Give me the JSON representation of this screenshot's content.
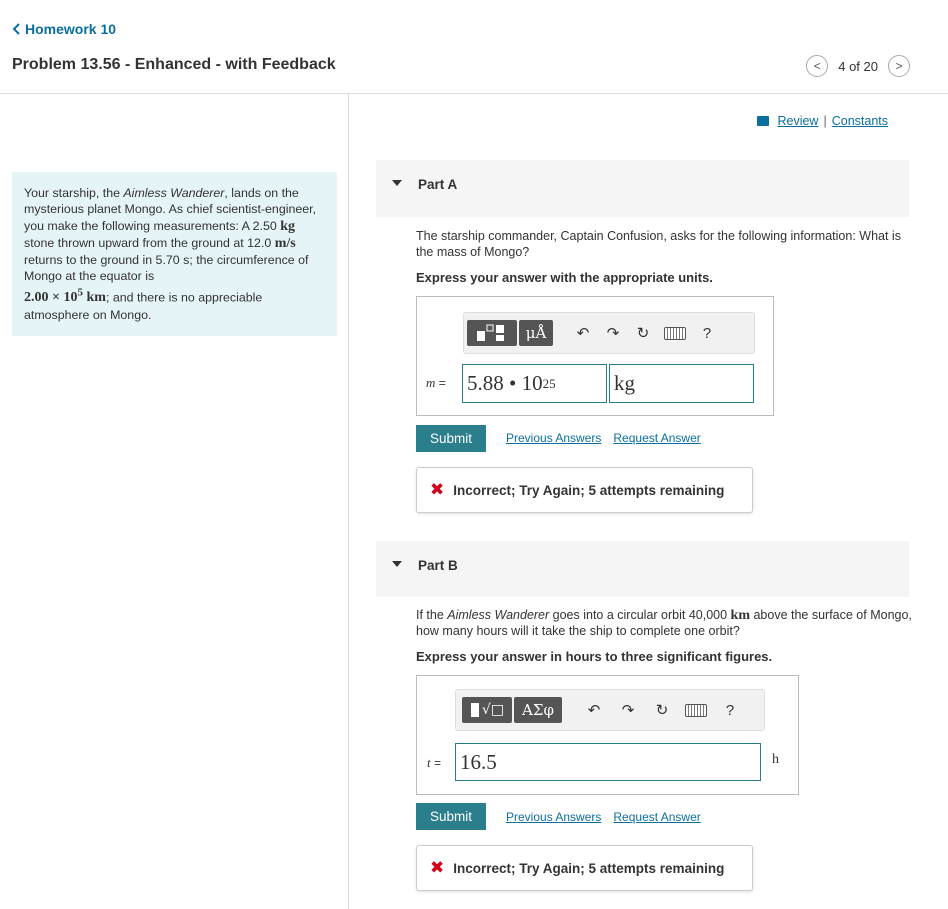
{
  "nav": {
    "back_label": "Homework 10"
  },
  "header": {
    "title": "Problem 13.56 - Enhanced - with Feedback",
    "pager": "4 of 20"
  },
  "links": {
    "review": "Review",
    "separator": "|",
    "constants": "Constants"
  },
  "problem": {
    "t1": "Your starship, the ",
    "ship": "Aimless Wanderer",
    "t2": ", lands on the mysterious planet Mongo. As chief scientist-engineer, you make the following measurements: A 2.50 ",
    "u_kg": "kg",
    "t3": " stone thrown upward from the ground at 12.0 ",
    "u_ms": "m/s",
    "t4": " returns to the ground in 5.70 s; the circumference of Mongo at the equator is",
    "circ": "2.00 × 10",
    "circ_exp": "5",
    "u_km": "km",
    "t5": "; and there is no appreciable atmosphere on Mongo."
  },
  "partA": {
    "label": "Part A",
    "question": "The starship commander, Captain Confusion, asks for the following information: What is the mass of Mongo?",
    "instruction": "Express your answer with the appropriate units.",
    "tb_units": "μÅ",
    "help": "?",
    "var": "m",
    "eq": " = ",
    "value": "5.88 • 10",
    "value_exp": "25",
    "unit": "kg",
    "submit": "Submit",
    "prev_answers": "Previous Answers",
    "request_answer": "Request Answer",
    "feedback": "Incorrect; Try Again; 5 attempts remaining"
  },
  "partB": {
    "label": "Part B",
    "q1": "If the ",
    "ship": "Aimless Wanderer",
    "q2": " goes into a circular orbit 40,000 ",
    "u_km": "km",
    "q3": " above the surface of Mongo, how many hours will it take the ship to complete one orbit?",
    "instruction": "Express your answer in hours to three significant figures.",
    "tb_greek": "ΑΣφ",
    "tb_sqrt": "√□",
    "help": "?",
    "var": "t",
    "eq": " = ",
    "value": "16.5",
    "unit": "h",
    "submit": "Submit",
    "prev_answers": "Previous Answers",
    "request_answer": "Request Answer",
    "feedback": "Incorrect; Try Again; 5 attempts remaining"
  },
  "colors": {
    "accent": "#2b7e8c",
    "link": "#0b6f9e",
    "problem_bg": "#e5f4f6",
    "error": "#d0021b"
  }
}
